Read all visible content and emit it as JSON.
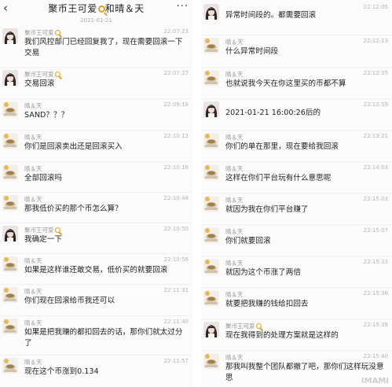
{
  "left": {
    "title": "聚币王可爱",
    "title_suffix": "和晴＆天",
    "date": "2021-01-21",
    "messages": [
      {
        "name": "聚币王可爱",
        "time": "22:07:23",
        "text": "我们风控部门已经回复我了，现在需要回滚一下交易"
      },
      {
        "name": "聚币王可爱",
        "time": "22:07:27",
        "text": "交易回滚"
      },
      {
        "name": "晴＆天",
        "time": "22:09:18",
        "text": "SAND？？？"
      },
      {
        "name": "晴＆天",
        "time": "22:10:13",
        "text": "你们是回滚卖出还是回滚买入"
      },
      {
        "name": "晴＆天",
        "time": "22:10:16",
        "text": "全部回滚吗"
      },
      {
        "name": "晴＆天",
        "time": "22:10:44",
        "text": "那我低价买的那个币怎么算？"
      },
      {
        "name": "聚币王可爱",
        "time": "22:10:50",
        "text": "我确定一下"
      },
      {
        "name": "晴＆天",
        "time": "22:10:56",
        "text": "如果是这样谁还敢交易，低价买的就要回滚"
      },
      {
        "name": "晴＆天",
        "time": "22:11:31",
        "text": "你们现在回滚给币我还可以"
      },
      {
        "name": "晴＆天",
        "time": "22:11:40",
        "text": "如果是把我赚的都扣回去的话，那你们就太过分了"
      },
      {
        "name": "晴＆天",
        "time": "22:11:57",
        "text": "现在这个币涨到0.134"
      }
    ]
  },
  "right": {
    "messages": [
      {
        "name": "",
        "time": "22:12:05",
        "text": "异常时间段的。都需要回滚"
      },
      {
        "name": "晴＆天",
        "time": "22:12:13",
        "text": "什么异常时间段"
      },
      {
        "name": "晴＆天",
        "time": "22:12:35",
        "text": "也就说我今天在你这里买的币都不算"
      },
      {
        "name": "",
        "time": "22:12:59",
        "text": "2021-01-21 16:00:26后的"
      },
      {
        "name": "晴＆天",
        "time": "22:13:21",
        "text": "你们的单在那里，现在要给我回滚"
      },
      {
        "name": "晴＆天",
        "time": "22:14:03",
        "text": "这样在你们平台玩有什么意思呢"
      },
      {
        "name": "晴＆天",
        "time": "22:15:03",
        "text": "就因为我在你们平台赚了"
      },
      {
        "name": "晴＆天",
        "time": "22:15:07",
        "text": "你们就要回滚"
      },
      {
        "name": "晴＆天",
        "time": "22:15:33",
        "text": "就因为这个币涨了两倍"
      },
      {
        "name": "晴＆天",
        "time": "22:15:36",
        "text": "就要把我赚的钱给扣回去"
      },
      {
        "name": "聚币王可爱",
        "time": "22:15:39",
        "text": "现在我得到的处理方案就是这样的"
      },
      {
        "name": "晴＆天",
        "time": "22:15:40",
        "text": "那我叫我整个团队都撤了吧，那你们这样玩没意思"
      }
    ]
  },
  "icons": {
    "back": "chevron-left",
    "more": "more-dots",
    "search": "magnifier"
  },
  "watermark": "IMAMI"
}
